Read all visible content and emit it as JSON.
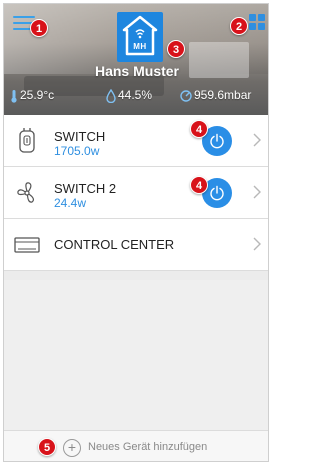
{
  "header": {
    "logo_text": "MH",
    "username": "Hans Muster",
    "stats": {
      "temperature": "25.9°c",
      "humidity": "44.5%",
      "pressure": "959.6mbar"
    }
  },
  "badges": [
    "1",
    "2",
    "3",
    "4",
    "4",
    "5"
  ],
  "devices": [
    {
      "name": "SWITCH",
      "power": "1705.0w",
      "icon": "plug-icon",
      "toggle": true
    },
    {
      "name": "SWITCH 2",
      "power": "24.4w",
      "icon": "fan-icon",
      "toggle": true
    },
    {
      "name": "CONTROL CENTER",
      "power": "",
      "icon": "hub-icon",
      "toggle": false
    }
  ],
  "footer": {
    "add_label": "Neues Gerät hinzufügen"
  },
  "colors": {
    "accent": "#2a8ee6",
    "badge": "#d8121a",
    "value_text": "#2f8fe0"
  }
}
